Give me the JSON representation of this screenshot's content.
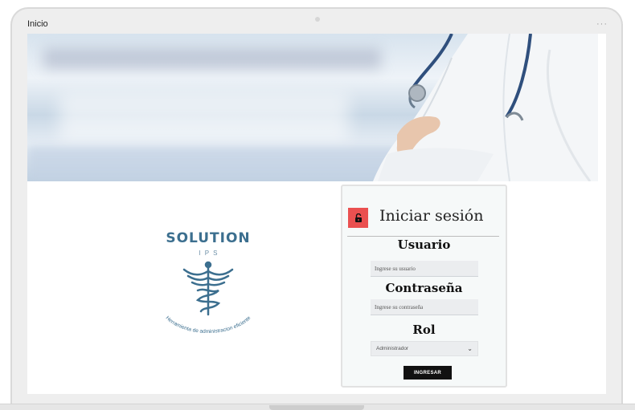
{
  "window": {
    "title": "Inicio",
    "menu_icon": "more-icon"
  },
  "brand": {
    "name": "SOLUTION",
    "sub": "IPS",
    "tagline": "Herramienta de administracion eficiente",
    "logo_icon": "caduceus-icon",
    "color": "#3c6f8f"
  },
  "login": {
    "title": "Iniciar sesión",
    "lock_icon": "unlocked-icon",
    "accent": "#ea5050",
    "user_label": "Usuario",
    "user_placeholder": "Ingrese su usuario",
    "password_label": "Contraseña",
    "password_placeholder": "Ingrese su contraseña",
    "role_label": "Rol",
    "role_selected": "Administrador",
    "submit_label": "INGRESAR"
  }
}
